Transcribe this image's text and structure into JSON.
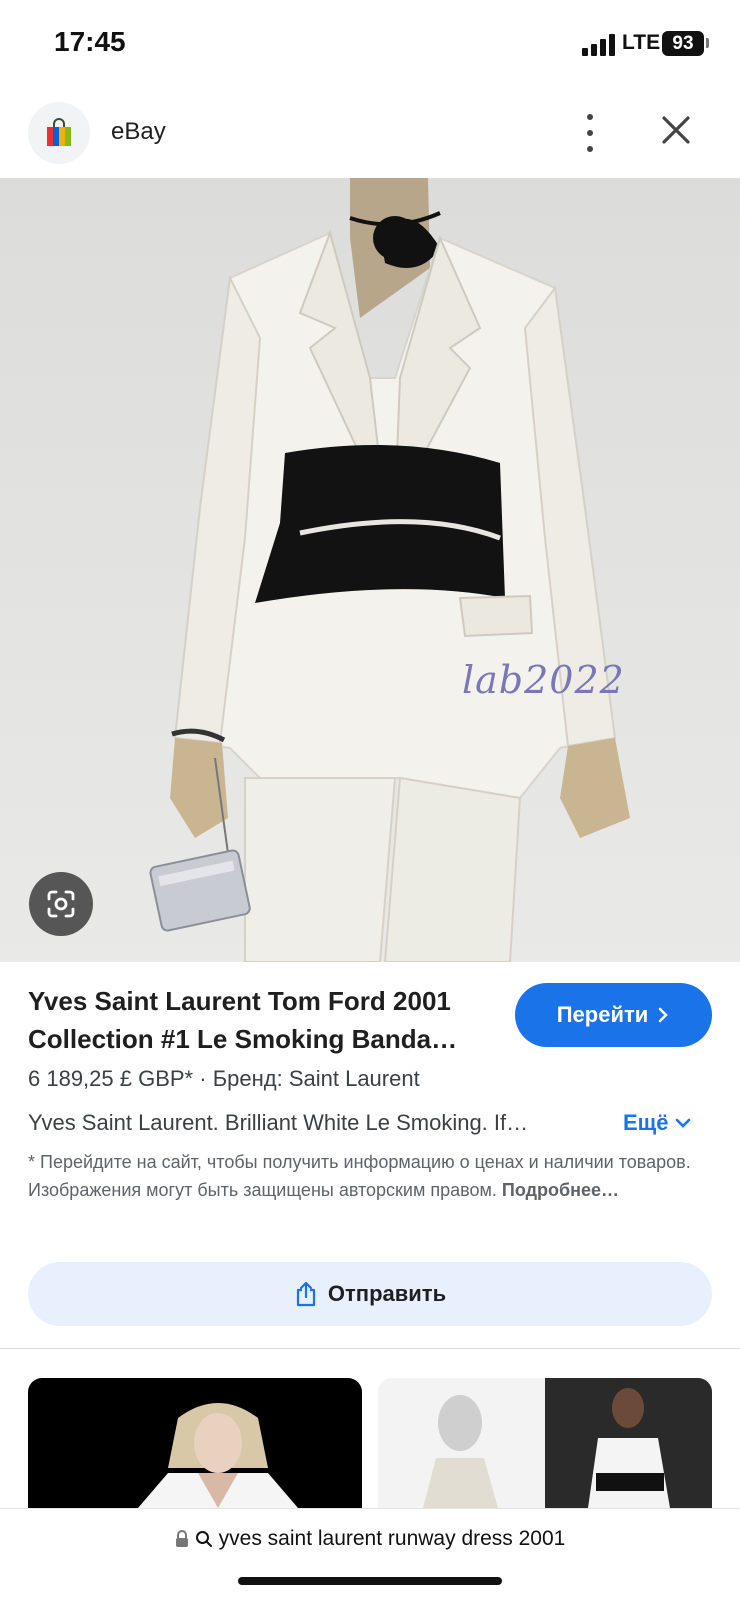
{
  "status_bar": {
    "time": "17:45",
    "network": "LTE",
    "battery": "93"
  },
  "header": {
    "site_name": "eBay"
  },
  "hero": {
    "watermark": "lab2022"
  },
  "product": {
    "title": "Yves Saint Laurent Tom Ford 2001 Collection #1 Le Smoking Banda…",
    "go_button_label": "Перейти",
    "price": "6 189,25 £ GBP*",
    "brand": "Бренд: Saint Laurent",
    "description": "Yves Saint Laurent. Brilliant White Le Smoking. If…",
    "more_label": "Ещё",
    "disclaimer": "* Перейдите на сайт, чтобы получить информацию о ценах и наличии товаров. Изображения могут быть защищены авторским правом.",
    "disclaimer_link": "Подробнее…"
  },
  "share_button_label": "Отправить",
  "address_bar": {
    "query": "yves saint laurent runway dress 2001"
  },
  "colors": {
    "accent": "#1a73e8",
    "share_bg": "#e8f0fe"
  }
}
